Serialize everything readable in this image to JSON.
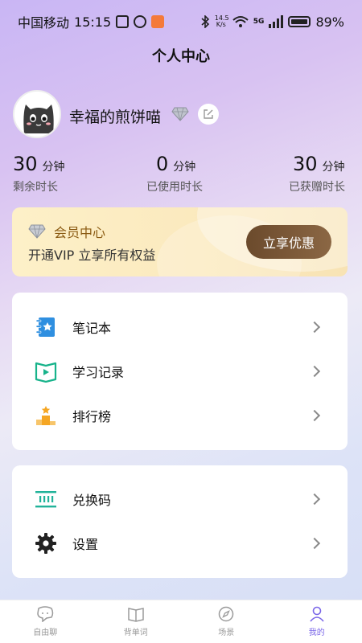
{
  "status_bar": {
    "carrier": "中国移动",
    "time": "15:15",
    "net_speed_value": "14.5",
    "net_speed_unit": "K/s",
    "net_type": "5G",
    "battery_percent": "89%",
    "battery_level": 0.89
  },
  "header": {
    "title": "个人中心"
  },
  "profile": {
    "nickname": "幸福的煎饼喵",
    "avatar_icon": "cat-avatar-icon",
    "gem_icon": "diamond-icon",
    "edit_icon": "edit-icon"
  },
  "stats": [
    {
      "value": "30",
      "unit": "分钟",
      "label": "剩余时长"
    },
    {
      "value": "0",
      "unit": "分钟",
      "label": "已使用时长"
    },
    {
      "value": "30",
      "unit": "分钟",
      "label": "已获赠时长"
    }
  ],
  "vip": {
    "title": "会员中心",
    "subtitle": "开通VIP 立享所有权益",
    "cta": "立享优惠",
    "accent_color": "#8a5a12",
    "cta_color": "#6b4a2c"
  },
  "menu_group_1": [
    {
      "label": "笔记本",
      "icon": "notebook-icon"
    },
    {
      "label": "学习记录",
      "icon": "play-record-icon"
    },
    {
      "label": "排行榜",
      "icon": "podium-icon"
    }
  ],
  "menu_group_2": [
    {
      "label": "兑换码",
      "icon": "barcode-icon"
    },
    {
      "label": "设置",
      "icon": "gear-icon"
    }
  ],
  "bottom_nav": [
    {
      "label": "自由聊",
      "icon": "chat-icon"
    },
    {
      "label": "背单词",
      "icon": "book-icon"
    },
    {
      "label": "场景",
      "icon": "compass-icon"
    },
    {
      "label": "我的",
      "icon": "user-icon",
      "active": true
    }
  ],
  "colors": {
    "active_tab": "#7a66e8",
    "notebook_blue": "#2f8fe0",
    "record_green": "#18b38b",
    "podium_orange": "#f5a623",
    "barcode_teal": "#22b39a"
  }
}
